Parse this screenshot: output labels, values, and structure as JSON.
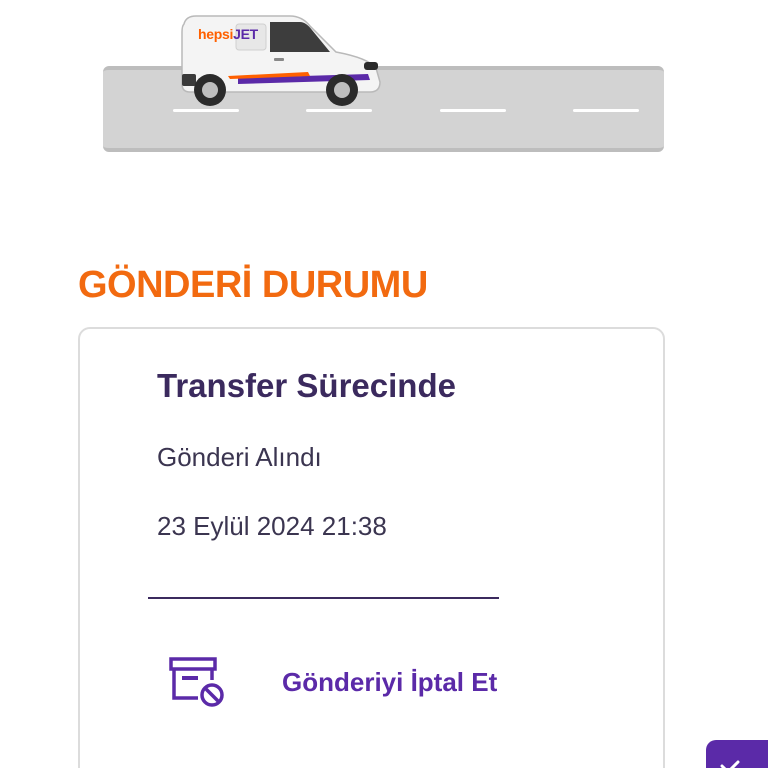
{
  "hero": {
    "brand": {
      "part1": "hepsi",
      "part2": "JET"
    }
  },
  "section": {
    "title": "GÖNDERİ DURUMU"
  },
  "status": {
    "title": "Transfer Sürecinde",
    "subtitle": "Gönderi Alındı",
    "datetime": "23 Eylül 2024 21:38"
  },
  "actions": {
    "cancel_label": "Gönderiyi İptal Et"
  },
  "colors": {
    "accent_orange": "#f26a10",
    "brand_purple": "#5b2aa8",
    "text_dark": "#3b2a5e"
  },
  "icons": {
    "cancel": "package-cancel-icon",
    "fab": "chevron-icon"
  }
}
